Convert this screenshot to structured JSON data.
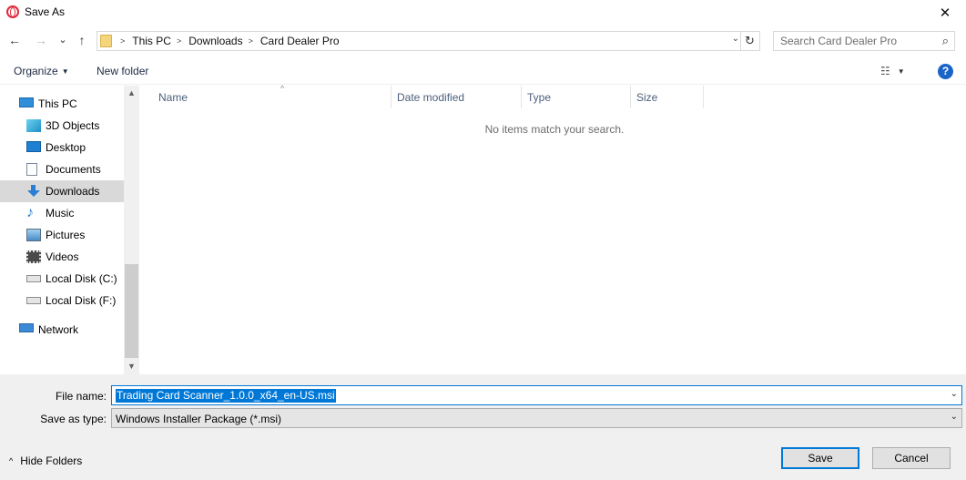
{
  "window": {
    "title": "Save As",
    "icon": "opera-icon",
    "close_glyph": "✕"
  },
  "nav": {
    "back_glyph": "←",
    "forward_glyph": "→",
    "recent_glyph": "⌄",
    "up_glyph": "↑"
  },
  "address": {
    "breadcrumbs": [
      "This PC",
      "Downloads",
      "Card Dealer Pro"
    ],
    "sep_glyph": ">",
    "dropdown_glyph": "⌄",
    "refresh_glyph": "↻"
  },
  "search": {
    "placeholder": "Search Card Dealer Pro",
    "icon_glyph": "⌕"
  },
  "toolbar": {
    "organize_label": "Organize",
    "new_folder_label": "New folder",
    "view_glyph": "☷",
    "help_glyph": "?",
    "caret_glyph": "▼"
  },
  "sidebar": {
    "items": [
      {
        "label": "This PC",
        "icon": "computer-icon",
        "level": 0,
        "selected": false
      },
      {
        "label": "3D Objects",
        "icon": "3d-objects-icon",
        "level": 1,
        "selected": false
      },
      {
        "label": "Desktop",
        "icon": "desktop-icon",
        "level": 1,
        "selected": false
      },
      {
        "label": "Documents",
        "icon": "documents-icon",
        "level": 1,
        "selected": false
      },
      {
        "label": "Downloads",
        "icon": "downloads-icon",
        "level": 1,
        "selected": true
      },
      {
        "label": "Music",
        "icon": "music-icon",
        "level": 1,
        "selected": false
      },
      {
        "label": "Pictures",
        "icon": "pictures-icon",
        "level": 1,
        "selected": false
      },
      {
        "label": "Videos",
        "icon": "videos-icon",
        "level": 1,
        "selected": false
      },
      {
        "label": "Local Disk (C:)",
        "icon": "disk-icon",
        "level": 1,
        "selected": false
      },
      {
        "label": "Local Disk (F:)",
        "icon": "disk-icon",
        "level": 1,
        "selected": false
      },
      {
        "label": "Network",
        "icon": "network-icon",
        "level": 0,
        "selected": false
      }
    ],
    "scroll_up_glyph": "▲",
    "scroll_down_glyph": "▼"
  },
  "filelist": {
    "columns": [
      "Name",
      "Date modified",
      "Type",
      "Size"
    ],
    "sort_glyph": "^",
    "empty_message": "No items match your search."
  },
  "form": {
    "file_name_label": "File name:",
    "file_name_value": "Trading Card Scanner_1.0.0_x64_en-US.msi",
    "save_type_label": "Save as type:",
    "save_type_value": "Windows Installer Package (*.msi)",
    "dropdown_glyph": "⌄"
  },
  "footer": {
    "hide_folders_label": "Hide Folders",
    "hide_folders_glyph": "^",
    "save_label": "Save",
    "cancel_label": "Cancel"
  },
  "colors": {
    "accent": "#0078d7",
    "selected_nav": "#d9d9d9",
    "bottom_panel": "#f0f0f0"
  }
}
